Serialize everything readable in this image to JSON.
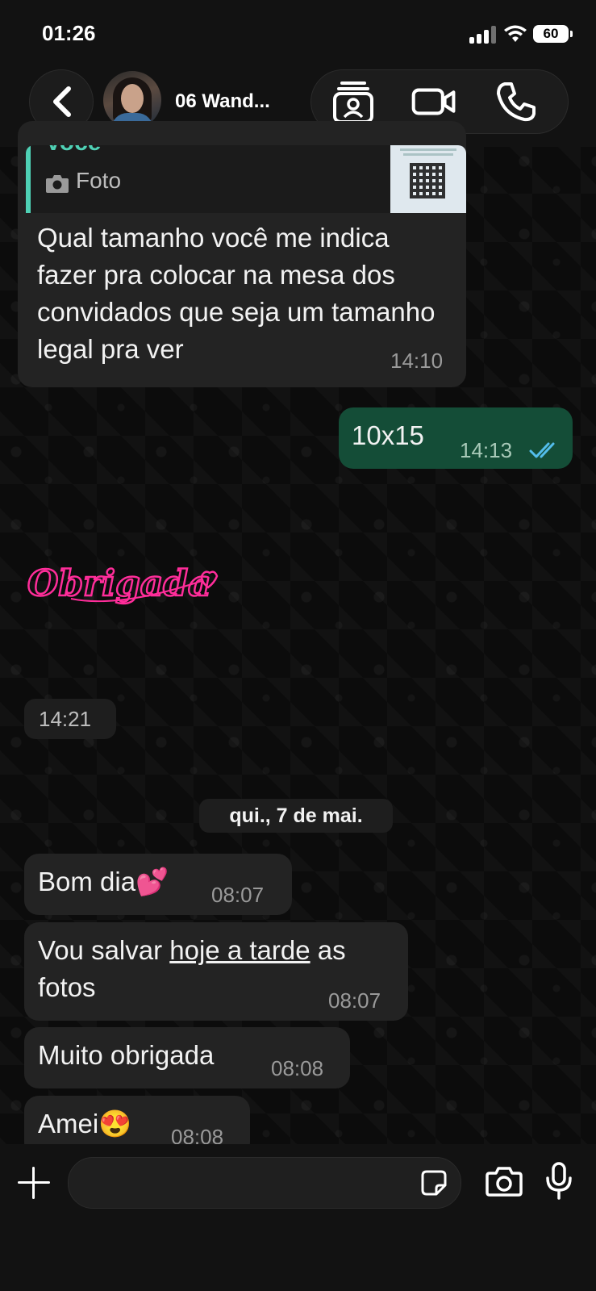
{
  "status_bar": {
    "time": "01:26",
    "battery": "60"
  },
  "header": {
    "contact_name": "06 Wand..."
  },
  "messages": {
    "quoted": {
      "author": "Você",
      "label": "Foto"
    },
    "m1": {
      "text": "Qual tamanho você me indica fazer pra colocar na mesa dos convidados que seja um tamanho legal pra ver",
      "time": "14:10"
    },
    "m2": {
      "text": "10x15",
      "time": "14:13"
    },
    "sticker": {
      "text": "Obrigada",
      "time": "14:21"
    },
    "date_separator": "qui., 7 de mai.",
    "m3": {
      "text": "Bom dia💕",
      "time": "08:07"
    },
    "m4": {
      "text_before": "Vou salvar ",
      "text_link": "hoje a tarde",
      "text_after": " as fotos",
      "time": "08:07"
    },
    "m5": {
      "text": "Muito obrigada",
      "time": "08:08"
    },
    "m6": {
      "text": "Amei😍",
      "time": "08:08"
    }
  },
  "composer": {
    "placeholder": ""
  },
  "colors": {
    "accent_teal": "#4fd1b5",
    "outgoing_bubble": "#144d37",
    "incoming_bubble": "#232323",
    "read_ticks": "#53bdeb",
    "sticker_pink": "#ff2d9a"
  },
  "icons": [
    "chevron-left-icon",
    "contact-card-icon",
    "video-camera-icon",
    "phone-icon",
    "camera-icon",
    "double-check-icon",
    "plus-icon",
    "sticker-icon",
    "microphone-icon"
  ]
}
